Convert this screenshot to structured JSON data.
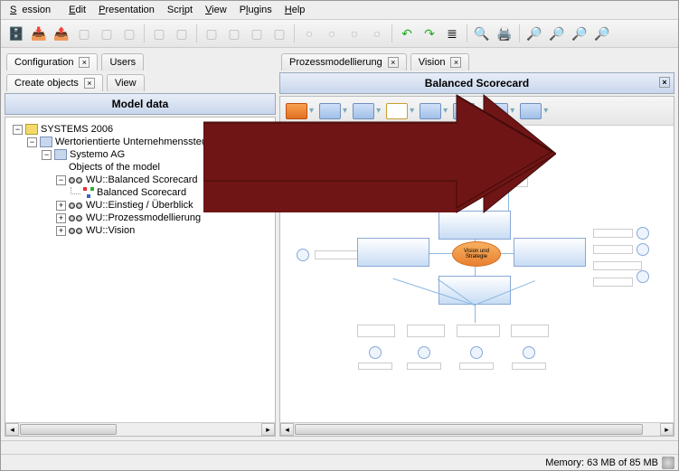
{
  "menu": {
    "session": "Session",
    "edit": "Edit",
    "presentation": "Presentation",
    "script": "Script",
    "view": "View",
    "plugins": "Plugins",
    "help": "Help"
  },
  "left": {
    "tabs": {
      "configuration": "Configuration",
      "users": "Users",
      "create_objects": "Create objects",
      "view": "View"
    },
    "header": "Model data",
    "tree": {
      "root": "SYSTEMS 2006",
      "n1": "Wertorientierte Unternehmenssteuerung",
      "n2": "Systemo AG",
      "n3": "Objects of the model",
      "n4": "WU::Balanced Scorecard",
      "n5": "Balanced Scorecard",
      "n6": "WU::Einstieg / Überblick",
      "n7": "WU::Prozessmodellierung",
      "n8": "WU::Vision"
    }
  },
  "right": {
    "tabs": {
      "proz": "Prozessmodellierung",
      "vision": "Vision"
    },
    "header": "Balanced Scorecard",
    "center_label": "Vision und Strategie"
  },
  "status": {
    "memory": "Memory: 63 MB of 85 MB"
  }
}
